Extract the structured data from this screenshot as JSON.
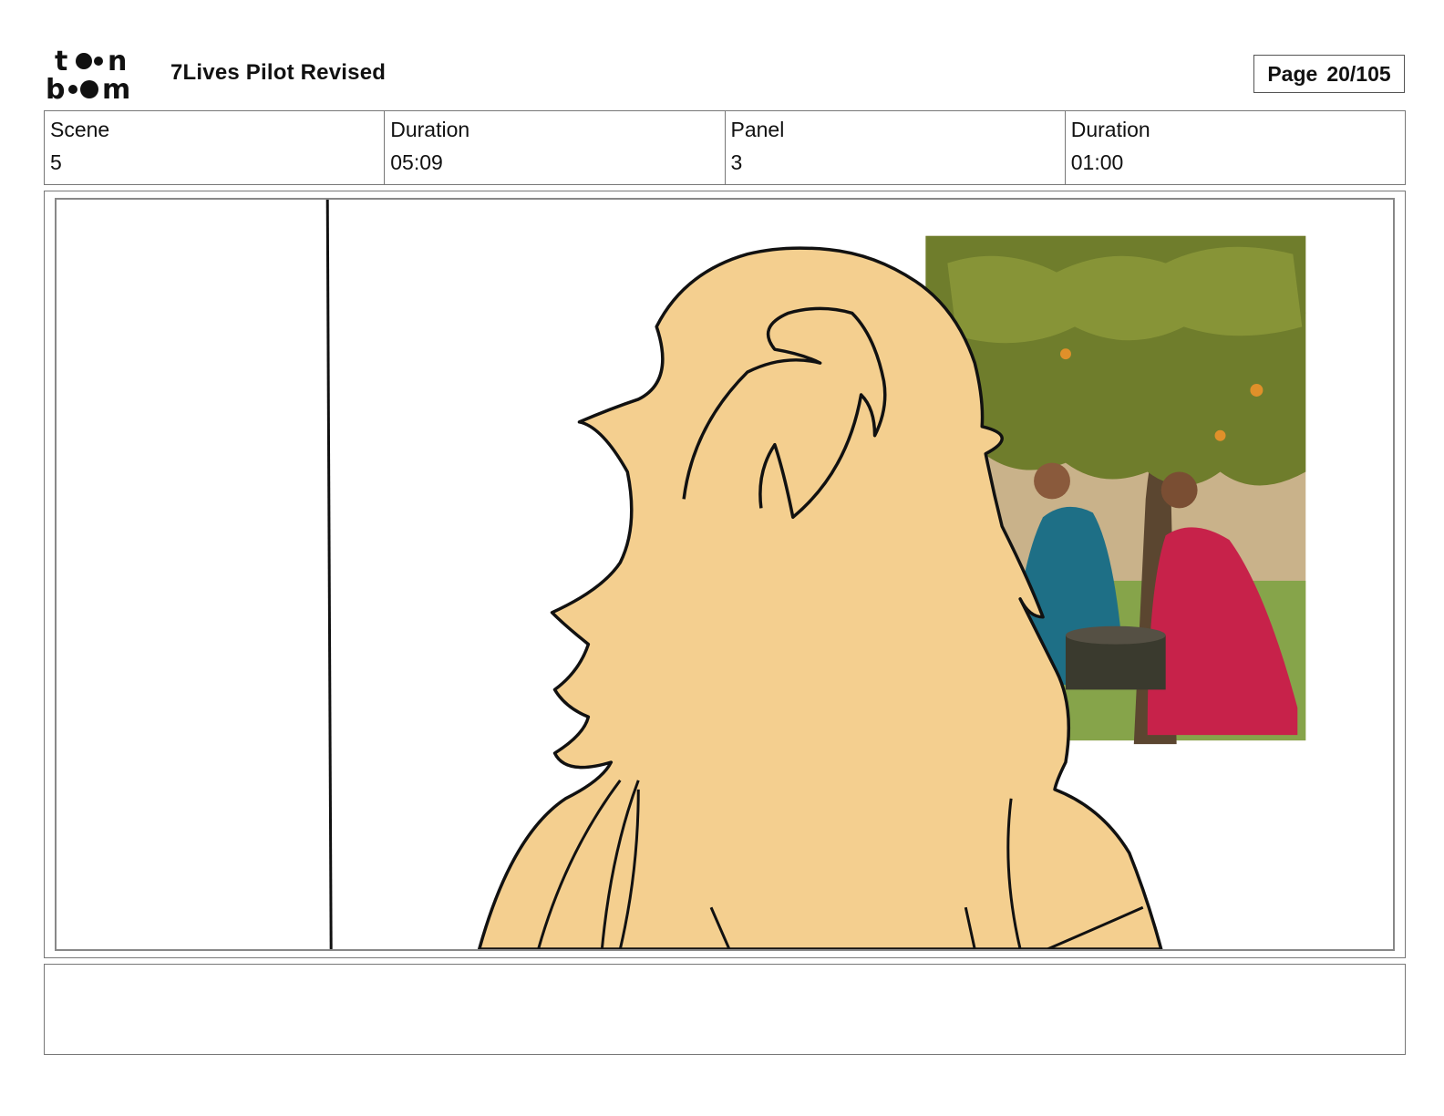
{
  "header": {
    "logo_text": "toonboom",
    "project_title": "7Lives Pilot Revised",
    "page_label": "Page",
    "page_value": "20/105"
  },
  "info": {
    "scene_label": "Scene",
    "scene_value": "5",
    "scene_duration_label": "Duration",
    "scene_duration_value": "05:09",
    "panel_label": "Panel",
    "panel_value": "3",
    "panel_duration_label": "Duration",
    "panel_duration_value": "01:00"
  },
  "colors": {
    "hair": "#f4cf8f",
    "outline": "#111111",
    "foliage": "#6f7d2c",
    "trunk": "#5b4630",
    "sari_blue": "#1e6f86",
    "sari_red": "#c7224a",
    "grass": "#7c9a3a"
  },
  "dialogue": {
    "text": ""
  }
}
